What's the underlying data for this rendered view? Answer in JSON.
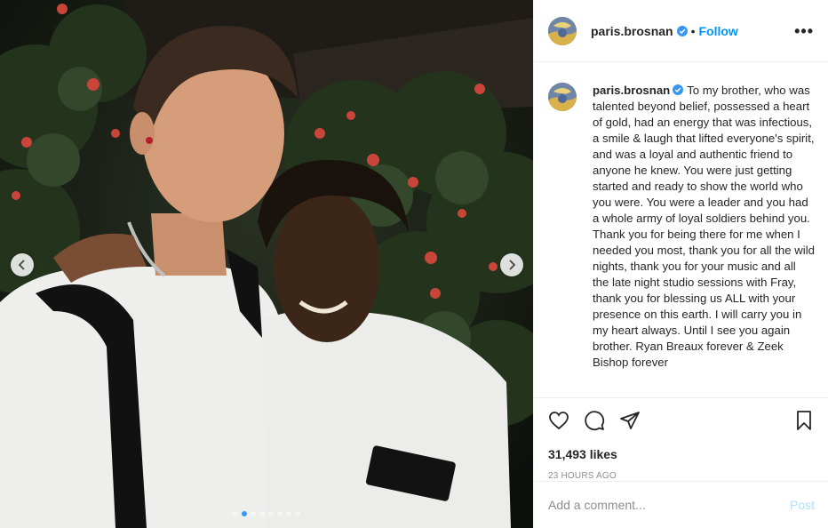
{
  "post": {
    "username": "paris.brosnan",
    "follow_label": "Follow",
    "bullet": "•",
    "more_label": "•••",
    "caption": "To my brother, who was talented beyond belief, possessed a heart of gold, had an energy that was infectious, a smile & laugh that lifted everyone's spirit, and was a loyal and authentic friend to anyone he knew. You were just getting started and ready to show the world who you were. You were a leader and you had a whole army of loyal soldiers behind you. Thank you for being there for me when I needed you most, thank you for all the wild nights, thank you for your music and all the late night studio sessions with Fray, thank you for blessing us ALL with your presence on this earth. I will carry you in my heart always. Until I see you again brother. Ryan Breaux forever & Zeek Bishop forever",
    "likes": "31,493 likes",
    "timestamp": "23 HOURS AGO"
  },
  "carousel": {
    "slide_count": 8,
    "active_index": 1
  },
  "comment": {
    "placeholder": "Add a comment...",
    "post_label": "Post"
  },
  "icons": {
    "verified": "verified-badge-icon",
    "like": "heart-icon",
    "comment": "comment-icon",
    "share": "paper-plane-icon",
    "save": "bookmark-icon",
    "prev": "chevron-left-icon",
    "next": "chevron-right-icon"
  },
  "colors": {
    "accent": "#0095f6",
    "verified": "#3897f0",
    "post_disabled": "#b2dffc",
    "muted": "#8e8e8e"
  }
}
